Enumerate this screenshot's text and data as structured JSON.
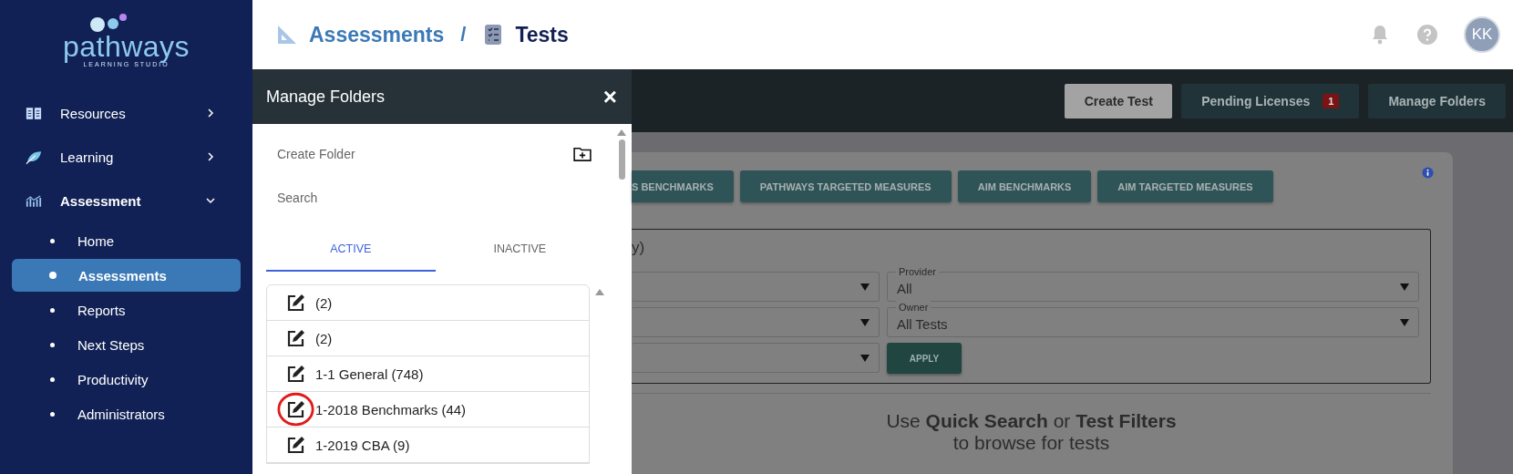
{
  "sidebar": {
    "logo": {
      "name": "pathways",
      "tagline": "LEARNING STUDIO"
    },
    "items": [
      {
        "label": "Resources",
        "expanded": false
      },
      {
        "label": "Learning",
        "expanded": false
      },
      {
        "label": "Assessment",
        "expanded": true,
        "children": [
          {
            "label": "Home",
            "selected": false
          },
          {
            "label": "Assessments",
            "selected": true
          },
          {
            "label": "Reports",
            "selected": false
          },
          {
            "label": "Next Steps",
            "selected": false
          },
          {
            "label": "Productivity",
            "selected": false
          },
          {
            "label": "Administrators",
            "selected": false
          }
        ]
      }
    ]
  },
  "header": {
    "breadcrumb": [
      {
        "label": "Assessments"
      },
      {
        "label": "Tests"
      }
    ],
    "separator": "/",
    "avatar": "KK"
  },
  "toolbar": {
    "buttons": [
      {
        "label": "Create Test",
        "kind": "primary"
      },
      {
        "label": "Pending Licenses",
        "kind": "badge",
        "badge": "1"
      },
      {
        "label": "Manage Folders",
        "kind": "plain"
      }
    ]
  },
  "drawer": {
    "title": "Manage Folders",
    "close": "×",
    "create_label": "Create Folder",
    "search": {
      "placeholder": "Search"
    },
    "tabs": [
      {
        "label": "ACTIVE",
        "selected": true
      },
      {
        "label": "INACTIVE",
        "selected": false
      }
    ],
    "folders": [
      {
        "label": "(2)",
        "highlighted": false
      },
      {
        "label": "(2)",
        "highlighted": false
      },
      {
        "label": "1-1 General (748)",
        "highlighted": false
      },
      {
        "label": "1-2018 Benchmarks (44)",
        "highlighted": true
      },
      {
        "label": "1-2019 CBA (9)",
        "highlighted": false
      }
    ]
  },
  "main": {
    "categories": [
      "S BENCHMARKS",
      "PATHWAYS TARGETED MEASURES",
      "AIM BENCHMARKS",
      "AIM TARGETED MEASURES"
    ],
    "filters_title": "y)",
    "filters": [
      {
        "kind": "select"
      },
      {
        "kind": "select",
        "label": "Provider",
        "value": "All"
      },
      {
        "kind": "select"
      },
      {
        "kind": "select",
        "label": "Owner",
        "value": "All Tests"
      },
      {
        "kind": "select"
      },
      {
        "kind": "button",
        "label": "APPLY"
      }
    ],
    "hint": "Use **Quick Search** or **Test Filters**",
    "hint_2": "to browse for tests"
  }
}
